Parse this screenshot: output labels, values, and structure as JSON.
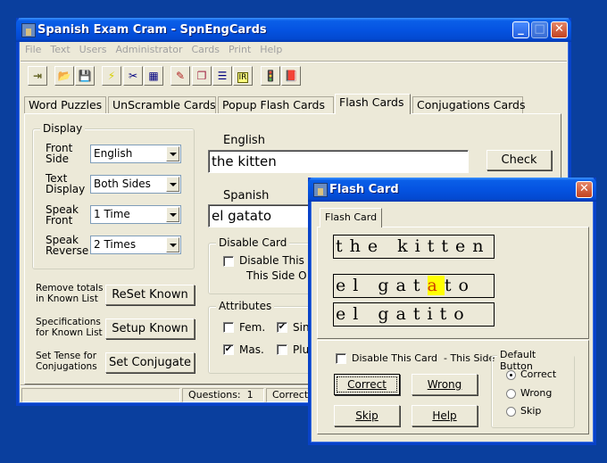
{
  "main_window": {
    "title": "Spanish Exam Cram - SpnEngCards",
    "menu": [
      "File",
      "Text",
      "Users",
      "Administrator",
      "Cards",
      "Print",
      "Help"
    ],
    "toolbar": [
      {
        "icon": "exit-door-icon",
        "glyph": "⇥"
      },
      {
        "icon": "open-folder-icon",
        "glyph": "📂"
      },
      {
        "icon": "save-disk-icon",
        "glyph": "💾"
      },
      {
        "icon": "lightning-icon",
        "glyph": "⚡"
      },
      {
        "icon": "scissors-icon",
        "glyph": "✂"
      },
      {
        "icon": "table-grid-icon",
        "glyph": "▦"
      },
      {
        "icon": "edit-note-icon",
        "glyph": "✎"
      },
      {
        "icon": "cards-stack-icon",
        "glyph": "❐"
      },
      {
        "icon": "list-document-icon",
        "glyph": "☰"
      },
      {
        "icon": "ir-book-icon",
        "glyph": "IR"
      },
      {
        "icon": "traffic-light-icon",
        "glyph": "🚦"
      },
      {
        "icon": "purple-book-icon",
        "glyph": "📕"
      }
    ],
    "tabs": [
      "Word Puzzles",
      "UnScramble Cards",
      "Popup Flash Cards",
      "Flash Cards",
      "Conjugations Cards"
    ],
    "active_tab": "Flash Cards",
    "display_group": {
      "title": "Display",
      "rows": [
        {
          "label": "Front Side",
          "value": "English"
        },
        {
          "label": "Text Display",
          "value": "Both Sides"
        },
        {
          "label": "Speak Front",
          "value": "1 Time"
        },
        {
          "label": "Speak Reverse",
          "value": "2 Times"
        }
      ]
    },
    "actions": [
      {
        "desc": "Remove totals in Known List",
        "button": "ReSet Known"
      },
      {
        "desc": "Specifications for Known List",
        "button": "Setup Known"
      },
      {
        "desc": "Set Tense for Conjugations",
        "button": "Set Conjugate"
      }
    ],
    "english_label": "English",
    "english_value": "the kitten",
    "check_button": "Check",
    "spanish_label": "Spanish",
    "spanish_value": "el gatato",
    "disable_group": {
      "title": "Disable Card",
      "checkbox_line1": "Disable This C",
      "checkbox_line2": "This Side O",
      "checked": false
    },
    "attributes_group": {
      "title": "Attributes",
      "items": [
        {
          "label": "Fem.",
          "checked": false
        },
        {
          "label": "Sin",
          "checked": true
        },
        {
          "label": "Mas.",
          "checked": true
        },
        {
          "label": "Plu",
          "checked": false
        }
      ]
    },
    "status": {
      "questions_label": "Questions:",
      "questions_value": "1",
      "correct_label": "Correct"
    }
  },
  "flash_dialog": {
    "title": "Flash Card",
    "tab": "Flash Card",
    "front_text": "the kitten",
    "answer_before": "el gat",
    "answer_highlight": "a",
    "answer_after": "to",
    "correct_text": "el gatito",
    "highlight_color": "#ffff00",
    "disable_checkbox": "Disable This Card  - This Side",
    "disable_checked": false,
    "buttons": {
      "correct": "Correct",
      "wrong": "Wrong",
      "skip": "Skip",
      "help": "Help"
    },
    "default_group": {
      "title": "Default Button",
      "options": [
        "Correct",
        "Wrong",
        "Skip"
      ],
      "selected": "Correct"
    }
  }
}
